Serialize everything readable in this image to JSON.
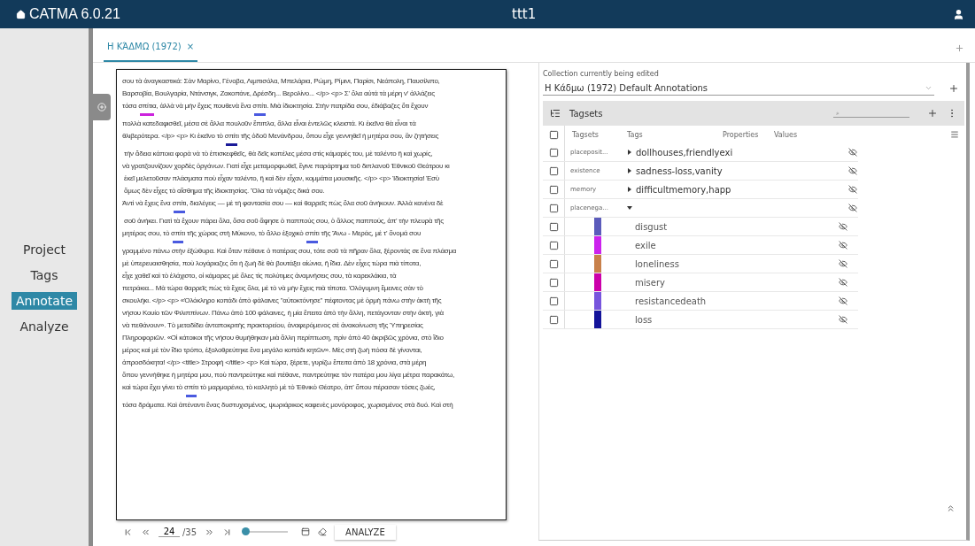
{
  "app": {
    "title": "CATMA 6.0.21",
    "project": "ttt1"
  },
  "nav": [
    {
      "label": "Project",
      "selected": false
    },
    {
      "label": "Tags",
      "selected": false
    },
    {
      "label": "Annotate",
      "selected": true
    },
    {
      "label": "Analyze",
      "selected": false
    }
  ],
  "tabs": [
    {
      "label": "Η ΚΆΔΜΩ (1972)",
      "close": "×",
      "selected": true
    }
  ],
  "document": {
    "lines": [
      [
        {
          "text": "σου τὰ ἀναγκαστικά: Σὰν Μαρίνο, Γένοβα, Λιμπισόλα, Μπελάρια, Ρώμη, Ρίμινι, Παρίσι, Νεάπολη, Παυσίλιπο,"
        }
      ],
      [
        {
          "text": "Βαρσοβία, Βουλγαρία, Ντάνσιγκ, Ζακοπάνε, Δρέσδη... Βερολίνο... </p> <p> Σ' ὅλα αὐτά τὰ μέρη ν' ἀλλάζεις"
        }
      ],
      [
        {
          "text": "τόσα "
        },
        {
          "text": "σπίτια",
          "color": "#cc22dd"
        },
        {
          "text": ", ἀλλὰ νὰ μὴν ἔχεις πουθενὰ ἕνα "
        },
        {
          "text": "σπίτι",
          "color": "#4a5ae0"
        },
        {
          "text": ". Μιὰ ἰδιοκτησία. Στὴν πατρίδα σου, ἐδιάβαζες ὅτι ἔχουν"
        }
      ],
      [
        {
          "text": "πολλὰ κατεδαφισθεῖ, μέσα σὲ ἄλλα πουλοῦν ἔπιπλα, ἄλλα εἶναι ἐντελῶς κλειστά. Κι ἐκεῖνα θὰ εἶναι τὰ"
        }
      ],
      [
        {
          "text": "θλιβερότερα. </p> <p> Κι ἐκεῖνο τὸ "
        },
        {
          "text": "σπίτι",
          "color": "#1a1a99"
        },
        {
          "text": " τῆς ὁδοῦ Μενάνδρου, ὅπου εἶχε γεννηθεῖ ἡ μητέρα σου, ἂν ζητήσεις"
        }
      ],
      [
        {
          "text": " τὴν ἄδεια κάποια φορὰ νὰ τὸ ἐπισκεφθεῖς, θὰ δεῖς κοπέλες μέσα στὶς κάμαρές του, μὲ ταλέντο ἢ καὶ χωρίς,"
        }
      ],
      [
        {
          "text": "νὰ γρατζουνίζουν χορδὲς ὀργάνων. Γιατί εἶχε μεταμορφωθεῖ, ἔγινε παράρτημα τοῦ διπλανοῦ Ἐθνικοῦ Θεάτρου κι"
        }
      ],
      [
        {
          "text": " ἐκεῖ μελετοῦσαν πλάσματα ποὺ εἶχαν ταλέντο, ἢ καὶ δὲν εἶχαν, κομμάτια μουσικῆς. </p> <p> Ἰδιοκτησία! Ἐσὺ"
        }
      ],
      [
        {
          "text": " ὅμως δὲν εἶχες τὸ αἴσθημα τῆς ἰδιοκτησίας. Ὅλα τὰ νόμιζες δικά σου."
        }
      ],
      [
        {
          "text": "Ἀντὶ νὰ ἔχεις ἕνα "
        },
        {
          "text": "σπίτι",
          "color": "#4a5ae0"
        },
        {
          "text": ", διαλέγεις — μὲ τὴ φαντασία σου — καὶ θαρρεῖς πὼς ὅλα σοῦ ἀνήκουν. Ἀλλὰ κανένα δὲ"
        }
      ],
      [
        {
          "text": " σοῦ ἀνήκει. Γιατὶ τὰ ἔχουν πάρει ὅλα, ὅσα σοῦ ἄφησε ὁ παππούς σου, ὁ ἄλλος παππούς, ἀπ' τὴν πλευρὰ τῆς"
        }
      ],
      [
        {
          "text": "μητέρας σου, τὸ "
        },
        {
          "text": "σπίτι",
          "color": "#4a5ae0"
        },
        {
          "text": " τῆς χώρας στὴ Μύκονο, τὸ ἄλλο ἐξοχικὸ "
        },
        {
          "text": "σπίτι",
          "color": "#4a5ae0"
        },
        {
          "text": " τῆς Ἄνω - Μεράς, μὲ τ' ὄνομά σου"
        }
      ],
      [
        {
          "text": "γραμμένο πάνω στὴν ἐξώθυρα. Καὶ ὅταν πέθανε ὁ πατέρας σου, τότε σοῦ τὰ πῆραν ὅλα, ξέροντάς σε ἕνα πλάσμα"
        }
      ],
      [
        {
          "text": "μὲ ὑπερευαισθησία, ποὺ λογάριαζες ὅτι ἡ ζωὴ δὲ θὰ βουτάξει αἰώνια, ἢ ἴδια. Δὲν εἶχες τώρα πιὰ τίποτα,"
        }
      ],
      [
        {
          "text": "εἶχε χαθεῖ καὶ τὸ ἐλάχιστο, οἱ κάμαρες μὲ ὅλες τὶς πολύτιμες ἀναμνήσεις σου, τὰ καρεκλάκια, τὰ"
        }
      ],
      [
        {
          "text": "πετράκια... Μὰ τώρα θαρρεῖς πὼς τὰ ἔχεις ὅλα, μὲ τὸ νὰ μὴν ἔχεις πιὰ τίποτα. Ὁλόγυμνη ἔμεινες σὰν τὸ"
        }
      ],
      [
        {
          "text": "σκουλήκι. </p> <p> «Ὁλόκληρο κοπάδι ἀπὸ φάλαινες \"αὐτοκτόνησε\" πέφτοντας μὲ ὁρμὴ πάνω στὴν ἀκτὴ τῆς"
        }
      ],
      [
        {
          "text": "νήσου Κουίο τῶν Φιλιππίνων. Πάνω ἀπὸ 100 φάλαινες, ἡ μία ἔπειτα ἀπὸ τὴν ἄλλη, πετάγονταν στὴν ἀκτή, γιὰ"
        }
      ],
      [
        {
          "text": "νὰ πεθάνουν». Τὸ μεταδίδει ἀνταποκριτὴς πρακτορείου, ἀναφερόμενος σὲ ἀνακοίνωση τῆς Ὑπηρεσίας"
        }
      ],
      [
        {
          "text": "Πληροφοριῶν. «Οἱ κάτοικοι τῆς νήσου θυμήθηκαν μιὰ ἄλλη περίπτωση, πρὶν ἀπὸ 40 ἀκριβῶς χρόνια, στὸ ἴδιο"
        }
      ],
      [
        {
          "text": "μέρος καὶ μὲ τὸν ἴδιο τρόπο, ἐξολοθρεύτηκε ἕνα μεγάλο κοπάδι κητῶν». Μὲς στὴ ζωὴ πόσα δὲ γίνονται,"
        }
      ],
      [
        {
          "text": "ἀπροσδόκητα! </p> <title> Στροφή </title> <p> Καὶ τώρα, ξέρετε, γυρίζω ἔπειτα ἀπὸ 18 χρόνια, στὰ μέρη"
        }
      ],
      [
        {
          "text": "ὅπου γεννήθηκε ἡ μητέρα μου, ποὺ παντρεύτηκε καὶ πέθανε, παντρεύτηκε τὸν πατέρα μου λίγα μέτρα παρακάτω,"
        }
      ],
      [
        {
          "text": "καὶ τώρα ἔχει γίνει τὸ "
        },
        {
          "text": "σπίτι",
          "color": "#4a5ae0"
        },
        {
          "text": " τὸ μαρμαρένιο, τὸ καλλητὸ μὲ τὸ Ἐθνικὸ Θέατρο, ἀπ' ὅπου πέρασαν τόσες ζωές,"
        }
      ],
      [
        {
          "text": "τόσα δράματα. Καὶ ἀπέναντι ἕνας δυστυχισμένος, ψωριάρικος καφενὲς μονόροφος, χωρισμένος στὰ δυό. Καὶ στὴ"
        }
      ]
    ]
  },
  "pager": {
    "page": "24",
    "total": "/35",
    "level": 0,
    "button": "ANALYZE"
  },
  "collection": {
    "label": "Collection currently being edited",
    "value": "Η Κάδμω (1972) Default Annotations"
  },
  "tagsets_panel": {
    "title": "Tagsets",
    "search_placeholder": "⌕",
    "columns": [
      "Tagsets",
      "Tags",
      "Properties",
      "Values"
    ],
    "all_checked": false,
    "rows": [
      {
        "tagset": "placeposit...",
        "tags": "dollhouses,friendlyexi",
        "expanded": false,
        "checked": false,
        "visible": false
      },
      {
        "tagset": "existence",
        "tags": "sadness-loss,vanity",
        "expanded": false,
        "checked": false,
        "visible": false
      },
      {
        "tagset": "memory",
        "tags": "difficultmemory,happ",
        "expanded": false,
        "checked": false,
        "visible": false
      },
      {
        "tagset": "placenega...",
        "expanded": true,
        "checked": false,
        "visible": false,
        "children": [
          {
            "tag": "disgust",
            "color": "#5b5bbb",
            "checked": false,
            "visible": false
          },
          {
            "tag": "exile",
            "color": "#cc22ee",
            "checked": false,
            "visible": false
          },
          {
            "tag": "loneliness",
            "color": "#c8804a",
            "checked": false,
            "visible": false
          },
          {
            "tag": "misery",
            "color": "#cc00aa",
            "checked": false,
            "visible": false
          },
          {
            "tag": "resistancedeath",
            "color": "#7755dd",
            "checked": false,
            "visible": false
          },
          {
            "tag": "loss",
            "color": "#13139a",
            "checked": false,
            "visible": false
          }
        ]
      }
    ]
  }
}
